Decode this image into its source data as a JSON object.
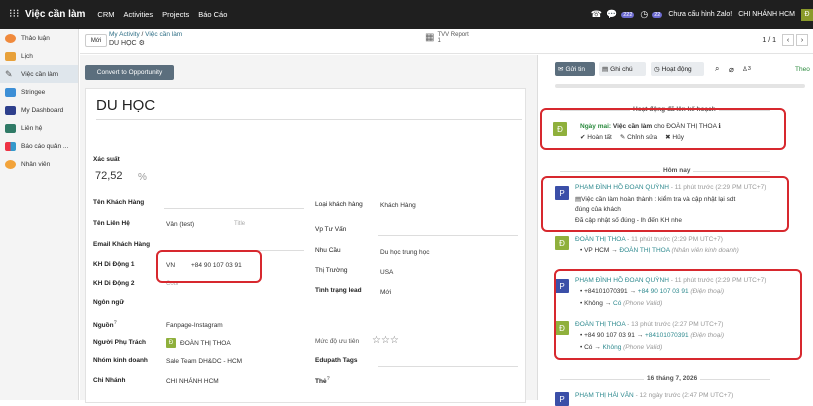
{
  "topbar": {
    "app_name": "Việc cần làm",
    "menu": [
      "CRM",
      "Activities",
      "Projects",
      "Báo Cáo"
    ],
    "msg_badge": "222",
    "activity_badge": "22",
    "zalo": "Chưa cấu hình Zalo!",
    "company": "CHI NHÁNH HCM",
    "user_initial": "Đ"
  },
  "sidebar": {
    "items": [
      "Thảo luận",
      "Lịch",
      "Việc cần làm",
      "Stringee",
      "My Dashboard",
      "Liên hệ",
      "Báo cáo quản ...",
      "Nhân viên"
    ]
  },
  "control": {
    "new_label": "Mới",
    "breadcrumb_1": "My Activity",
    "breadcrumb_2": "Việc cần làm",
    "record_title": "DU HỌC",
    "tvv_label": "TVV Report",
    "tvv_count": "1",
    "pager": "1 / 1"
  },
  "form": {
    "convert_label": "Convert to Opportunity",
    "name": "DU HỌC",
    "prob_label": "Xác suất",
    "prob_value": "72,52",
    "prob_unit": "%",
    "left": {
      "customer_label": "Tên Khách Hàng",
      "contact_label": "Tên Liên Hệ",
      "contact_value": "Vân (test)",
      "contact_title_ph": "Title",
      "email_label": "Email Khách Hàng",
      "mobile1_label": "KH Di Động 1",
      "mobile1_country": "VN",
      "mobile1_number": "+84 90 107 03 91",
      "mobile2_label": "KH Di Động 2",
      "mobile2_ph": "Cour",
      "lang_label": "Ngôn ngữ",
      "source_label": "Nguồn",
      "source_value": "Fanpage-Instagram",
      "owner_label": "Người Phụ Trách",
      "owner_value": "ĐOÀN THỊ THOA",
      "owner_initial": "Đ",
      "team_label": "Nhóm kinh doanh",
      "team_value": "Sale Team DH&DC - HCM",
      "branch_label": "Chi Nhánh",
      "branch_value": "CHI NHÁNH HCM"
    },
    "right": {
      "type_label": "Loại khách hàng",
      "type_value": "Khách Hàng",
      "advisor_label": "Vp Tư Vấn",
      "need_label": "Nhu Cầu",
      "need_value": "Du học trung học",
      "market_label": "Thị Trường",
      "market_value": "USA",
      "status_label": "Tình trạng lead",
      "status_value": "Mới",
      "priority_label": "Mức độ ưu tiên",
      "priority_stars": "☆☆☆",
      "edupath_label": "Edupath Tags",
      "tag_label": "Thẻ"
    }
  },
  "chatter": {
    "send_label": "Gửi tin",
    "note_label": "Ghi chú",
    "activity_label": "Hoạt động",
    "followers_count": "3",
    "follow_label": "Theo",
    "planned_header": "Hoạt động đã lên kế hoạch",
    "planned": {
      "initial": "Đ",
      "when": "Ngày mai:",
      "type": "Việc cần làm",
      "for": "cho ĐOÀN THỊ THOA",
      "done": "Hoàn tất",
      "edit": "Chỉnh sửa",
      "cancel": "Hủy"
    },
    "today_header": "Hôm nay",
    "messages": [
      {
        "initial": "P",
        "author": "PHẠM ĐÌNH HỒ ĐOAN QUỲNH",
        "time": "- 11 phút trước (2:29 PM UTC+7)",
        "lines": [
          "Việc cần làm hoàn thành : kiểm tra và cập nhật lại sdt",
          "đúng của khách",
          "Đã cập nhật số đúng - lh đến KH nhe"
        ]
      },
      {
        "initial": "Đ",
        "author": "ĐOÀN THỊ THOA",
        "time": "- 11 phút trước (2:29 PM UTC+7)",
        "change_old": "VP HCM",
        "change_new": "ĐOÀN THỊ THOA",
        "change_field": "(Nhân viên kinh doanh)"
      },
      {
        "initial": "P",
        "author": "PHẠM ĐÌNH HỒ ĐOAN QUỲNH",
        "time": "- 11 phút trước (2:29 PM UTC+7)",
        "c1_old": "+84101070391",
        "c1_new": "+84 90 107 03 91",
        "c1_field": "(Điện thoại)",
        "c2_old": "Không",
        "c2_new": "Có",
        "c2_field": "(Phone Valid)"
      },
      {
        "initial": "Đ",
        "author": "ĐOÀN THỊ THOA",
        "time": "- 13 phút trước (2:27 PM UTC+7)",
        "c1_old": "+84 90 107 03 91",
        "c1_new": "+84101070391",
        "c1_field": "(Điện thoại)",
        "c2_old": "Có",
        "c2_new": "Không",
        "c2_field": "(Phone Valid)"
      }
    ],
    "date_header": "16 tháng 7, 2026",
    "last": {
      "initial": "P",
      "author": "PHẠM THỊ HẢI VÂN",
      "time": "- 12 ngày trước (2:47 PM UTC+7)"
    }
  }
}
